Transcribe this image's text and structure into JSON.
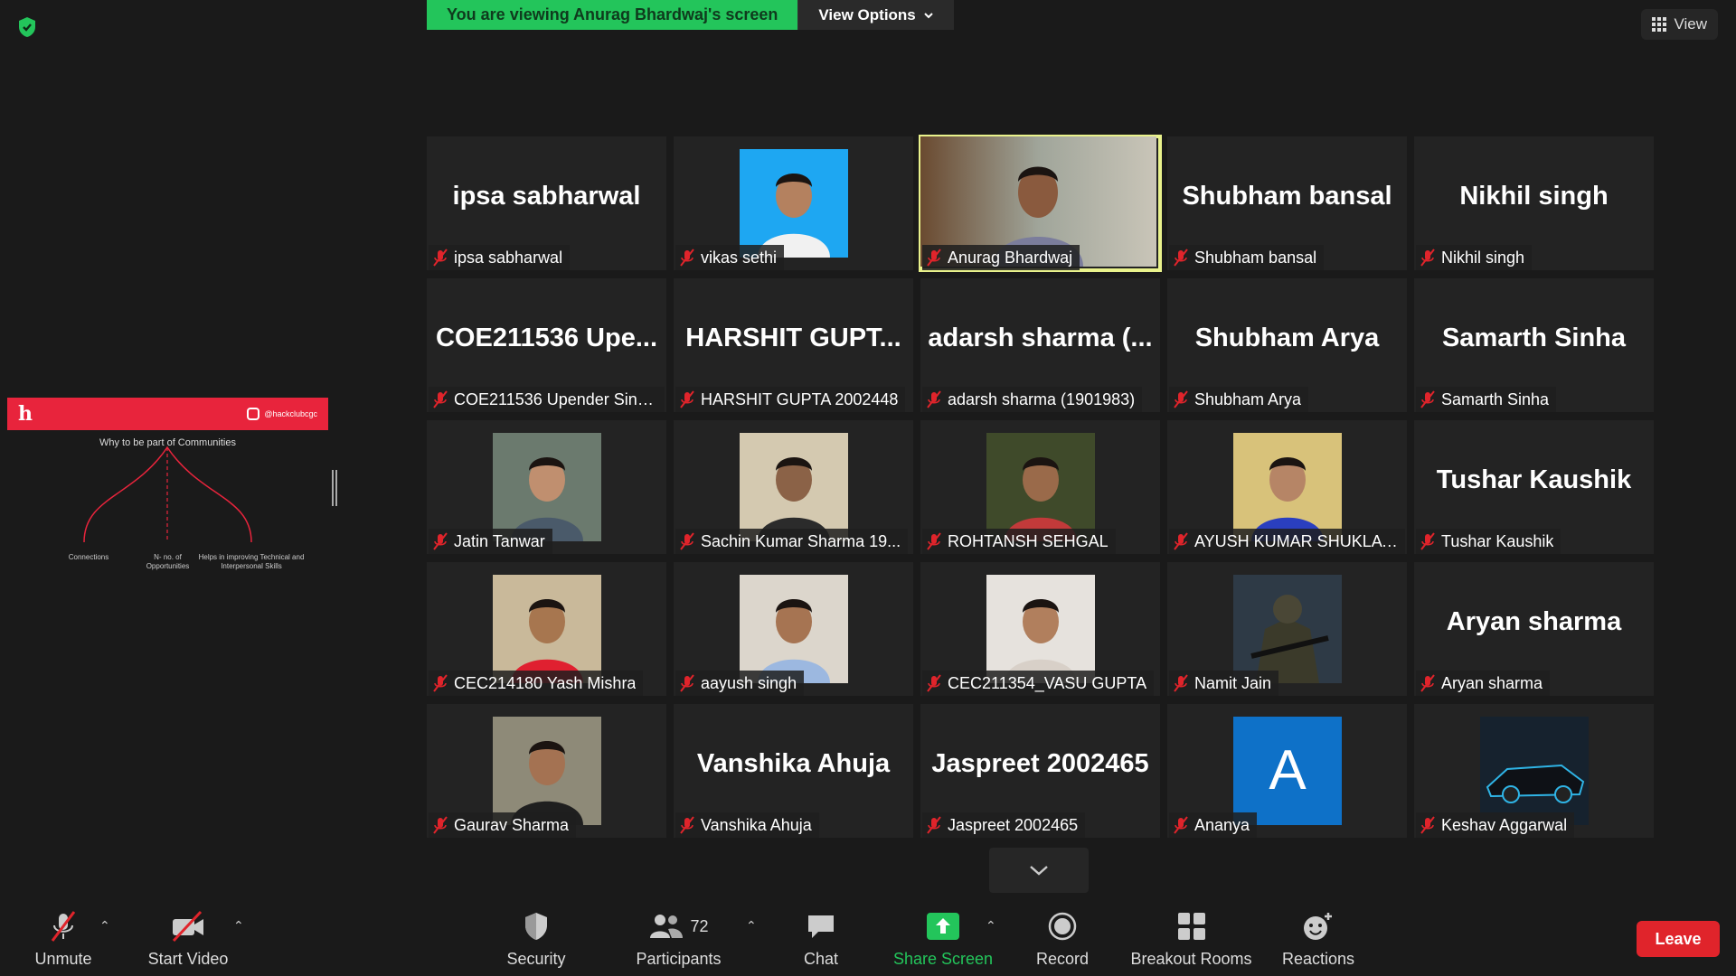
{
  "banner": {
    "viewing_text": "You are viewing Anurag Bhardwaj's screen",
    "view_options_label": "View Options"
  },
  "top_right": {
    "view_label": "View"
  },
  "shared_slide": {
    "logo": "h",
    "handle": "@hackclubcgc",
    "title": "Why to be part of Communities",
    "labels": [
      "Connections",
      "N- no. of Opportunities",
      "Helps in improving Technical and Interpersonal Skills"
    ],
    "accent_color": "#e8243c"
  },
  "participants": [
    {
      "big": "ipsa sabharwal",
      "label": "ipsa sabharwal",
      "photo": null
    },
    {
      "big": "",
      "label": "vikas sethi",
      "photo": "person-blue"
    },
    {
      "big": "",
      "label": "Anurag Bhardwaj",
      "photo": "live-video",
      "active": true
    },
    {
      "big": "Shubham bansal",
      "label": "Shubham bansal",
      "photo": null
    },
    {
      "big": "Nikhil singh",
      "label": "Nikhil singh",
      "photo": null
    },
    {
      "big": "COE211536  Upe...",
      "label": "COE211536 Upender Sing...",
      "photo": null
    },
    {
      "big": "HARSHIT  GUPT...",
      "label": "HARSHIT GUPTA 2002448",
      "photo": null
    },
    {
      "big": "adarsh  sharma  (...",
      "label": "adarsh sharma (1901983)",
      "photo": null
    },
    {
      "big": "Shubham Arya",
      "label": "Shubham Arya",
      "photo": null
    },
    {
      "big": "Samarth Sinha",
      "label": "Samarth Sinha",
      "photo": null
    },
    {
      "big": "",
      "label": "Jatin Tanwar",
      "photo": "person-glasses"
    },
    {
      "big": "",
      "label": "Sachin Kumar Sharma 19...",
      "photo": "person-lake"
    },
    {
      "big": "",
      "label": "ROHTANSH SEHGAL",
      "photo": "person-trees"
    },
    {
      "big": "",
      "label": "AYUSH KUMAR SHUKLA ...",
      "photo": "person-office"
    },
    {
      "big": "Tushar Kaushik",
      "label": "Tushar Kaushik",
      "photo": null
    },
    {
      "big": "",
      "label": "CEC214180 Yash Mishra",
      "photo": "person-red"
    },
    {
      "big": "",
      "label": "aayush singh",
      "photo": "person-white"
    },
    {
      "big": "",
      "label": "CEC211354_VASU GUPTA",
      "photo": "person-plain"
    },
    {
      "big": "",
      "label": "Namit Jain",
      "photo": "soldier"
    },
    {
      "big": "Aryan sharma",
      "label": "Aryan sharma",
      "photo": null
    },
    {
      "big": "",
      "label": "Gaurav Sharma",
      "photo": "person-dark"
    },
    {
      "big": "Vanshika Ahuja",
      "label": "Vanshika Ahuja",
      "photo": null
    },
    {
      "big": "Jaspreet 2002465",
      "label": "Jaspreet 2002465",
      "photo": null
    },
    {
      "big": "",
      "label": "Ananya",
      "photo": "letter-avatar",
      "letter": "A"
    },
    {
      "big": "",
      "label": "Keshav Aggarwal",
      "photo": "car"
    }
  ],
  "toolbar": {
    "unmute": "Unmute",
    "start_video": "Start Video",
    "security": "Security",
    "participants": "Participants",
    "participants_count": "72",
    "chat": "Chat",
    "share_screen": "Share Screen",
    "record": "Record",
    "breakout_rooms": "Breakout Rooms",
    "reactions": "Reactions",
    "leave": "Leave"
  },
  "colors": {
    "share_green": "#23c55b",
    "active_speaker": "#e9f28c",
    "leave_red": "#e0242b",
    "mic_muted": "#e0242b"
  }
}
